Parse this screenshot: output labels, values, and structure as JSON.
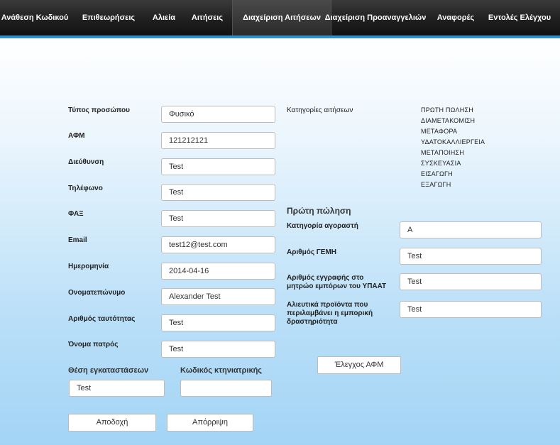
{
  "nav": {
    "items": [
      {
        "label": "Ανάθεση Κωδικού"
      },
      {
        "label": "Επιθεωρήσεις"
      },
      {
        "label": "Αλιεία"
      },
      {
        "label": "Αιτήσεις"
      },
      {
        "label": "Διαχείριση Αιτήσεων",
        "active": true
      },
      {
        "label": "Διαχείριση Προαναγγελιών"
      },
      {
        "label": "Αναφορές"
      },
      {
        "label": "Εντολές Ελέγχου"
      }
    ]
  },
  "form": {
    "fields": [
      {
        "label": "Τύπος προσώπου",
        "value": "Φυσικό"
      },
      {
        "label": "ΑΦΜ",
        "value": "121212121"
      },
      {
        "label": "Διεύθυνση",
        "value": "Test"
      },
      {
        "label": "Τηλέφωνο",
        "value": "Test"
      },
      {
        "label": "ΦΑΞ",
        "value": "Test"
      },
      {
        "label": "Email",
        "value": "test12@test.com"
      },
      {
        "label": "Ημερομηνία",
        "value": "2014-04-16"
      },
      {
        "label": "Ονοματεπώνυμο",
        "value": "Alexander Test"
      },
      {
        "label": "Αριθμός ταυτότητας",
        "value": "Test"
      },
      {
        "label": "Όνομα πατρός",
        "value": "Test"
      }
    ],
    "installation_position": {
      "label": "Θέση εγκαταστάσεων",
      "value": "Test"
    },
    "vet_code": {
      "label": "Κωδικός κτηνιατρικής",
      "value": ""
    },
    "accept_label": "Αποδοχή",
    "reject_label": "Απόρριψη"
  },
  "categories": {
    "label": "Κατηγορίες αιτήσεων",
    "items": [
      "ΠΡΩΤΗ ΠΩΛΗΣΗ",
      "ΔΙΑΜΕΤΑΚΟΜΙΣΗ",
      "ΜΕΤΑΦΟΡΑ",
      "ΥΔΑΤΟΚΑΛΛΙΕΡΓΕΙΑ",
      "ΜΕΤΑΠΟΙΗΣΗ",
      "ΣΥΣΚΕΥΑΣΙΑ",
      "ΕΙΣΑΓΩΓΗ",
      "ΕΞΑΓΩΓΗ"
    ]
  },
  "first_sale": {
    "title": "Πρώτη πώληση",
    "fields": [
      {
        "label": "Κατηγορία αγοραστή",
        "value": "Α"
      },
      {
        "label": "Αριθμός ΓΕΜΗ",
        "value": "Test"
      },
      {
        "label": "Αριθμός εγγραφής στο μητρώο εμπόρων του ΥΠΑΑΤ",
        "value": "Test"
      },
      {
        "label": "Αλιευτικά προϊόντα που περιλαμβάνει η εμπορική δραστηριότητα",
        "value": "Test"
      }
    ],
    "check_afm_label": "Έλεγχος ΑΦΜ"
  }
}
